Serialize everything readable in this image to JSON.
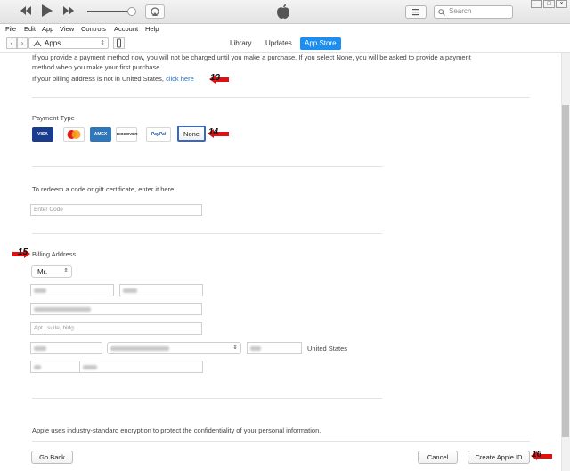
{
  "menu": [
    "File",
    "Edit",
    "App",
    "View",
    "Controls",
    "Account",
    "Help"
  ],
  "search_placeholder": "Search",
  "window_controls": {
    "minimize": "–",
    "maximize": "□",
    "close": "×"
  },
  "nav": {
    "back": "‹",
    "forward": "›",
    "source_label": "Apps",
    "tabs": [
      "Library",
      "Updates",
      "App Store"
    ],
    "active_tab": "App Store"
  },
  "intro": {
    "line1": "If you provide a payment method now, you will not be charged until you make a purchase. If you select None, you will be asked to provide a payment",
    "line2": "method when you make your first purchase.",
    "billing_note": "If your billing address is not in United States,",
    "billing_link": "click here"
  },
  "payment": {
    "label": "Payment Type",
    "cards": [
      "VISA",
      "MasterCard",
      "AMEX",
      "DISCOVER",
      "PayPal"
    ],
    "none_label": "None"
  },
  "redeem": {
    "label": "To redeem a code or gift certificate, enter it here.",
    "placeholder": "Enter Code"
  },
  "billing": {
    "label": "Billing Address",
    "title_value": "Mr.",
    "apt_placeholder": "Apt., suite, bldg.",
    "country": "United States"
  },
  "footer": {
    "security_note": "Apple uses industry-standard encryption to protect the confidentiality of your personal information.",
    "go_back": "Go Back",
    "cancel": "Cancel",
    "create": "Create Apple ID"
  },
  "annotations": [
    "13",
    "14",
    "15",
    "16"
  ],
  "colors": {
    "accent": "#1b8ef0",
    "link": "#1f6fc5",
    "annotation_arrow": "#e01010"
  }
}
